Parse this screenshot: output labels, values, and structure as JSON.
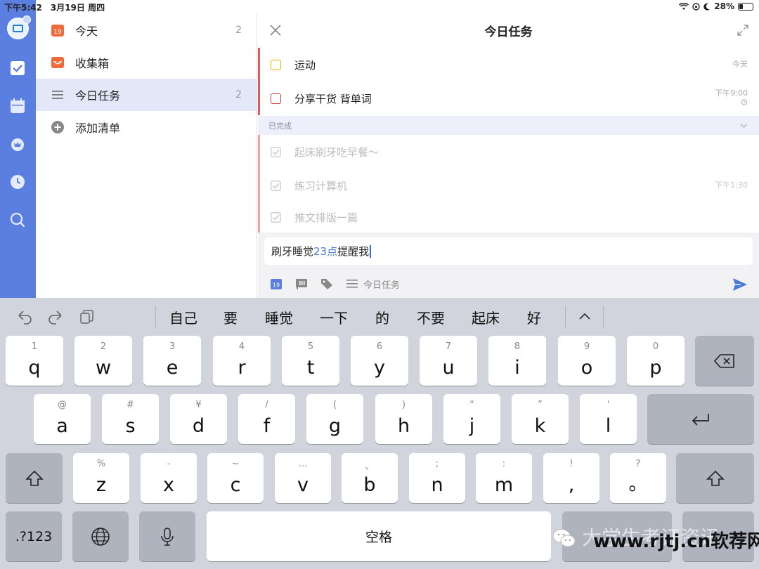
{
  "status_bar": {
    "time": "下午5:42",
    "date": "3月19日 周四",
    "battery": "28%",
    "battery_level": 0.28
  },
  "rail": {
    "icons": [
      "avatar-icon",
      "checkbox-icon",
      "calendar-icon",
      "habit-icon",
      "clock-icon",
      "search-icon"
    ]
  },
  "lists": {
    "items": [
      {
        "label": "今天",
        "count": "2",
        "icon": "calendar-19-icon",
        "icon_color": "#f06a3c",
        "date_badge": "19"
      },
      {
        "label": "收集箱",
        "count": "",
        "icon": "inbox-icon",
        "icon_color": "#f06a3c"
      },
      {
        "label": "今日任务",
        "count": "2",
        "icon": "list-icon",
        "icon_color": "#777777"
      },
      {
        "label": "添加清单",
        "count": "",
        "icon": "add-circle-icon",
        "icon_color": "#888888"
      }
    ]
  },
  "detail": {
    "title": "今日任务",
    "tasks": [
      {
        "label": "运动",
        "meta": "今天",
        "checkbox_color": "#f0b400"
      },
      {
        "label": "分享干货 背单词",
        "meta": "下午9:00",
        "checkbox_color": "#d04040"
      }
    ],
    "done_label": "已完成",
    "done_tasks": [
      {
        "label": "起床刷牙吃早餐～",
        "meta": ""
      },
      {
        "label": "练习计算机",
        "meta": "下午1:30"
      },
      {
        "label": "推文排版一篇",
        "meta": ""
      }
    ],
    "input": {
      "before": "刷牙睡觉 ",
      "highlight": "23点",
      "after": "提醒我"
    },
    "tools": {
      "list_name": "今日任务",
      "date_badge": "19"
    }
  },
  "keyboard": {
    "suggestions": [
      "自己",
      "要",
      "睡觉",
      "一下",
      "的",
      "不要",
      "起床",
      "好"
    ],
    "row1": [
      {
        "main": "q",
        "alt": "1"
      },
      {
        "main": "w",
        "alt": "2"
      },
      {
        "main": "e",
        "alt": "3"
      },
      {
        "main": "r",
        "alt": "4"
      },
      {
        "main": "t",
        "alt": "5"
      },
      {
        "main": "y",
        "alt": "6"
      },
      {
        "main": "u",
        "alt": "7"
      },
      {
        "main": "i",
        "alt": "8"
      },
      {
        "main": "o",
        "alt": "9"
      },
      {
        "main": "p",
        "alt": "0"
      }
    ],
    "row2": [
      {
        "main": "a",
        "alt": "@"
      },
      {
        "main": "s",
        "alt": "#"
      },
      {
        "main": "d",
        "alt": "¥"
      },
      {
        "main": "f",
        "alt": "/"
      },
      {
        "main": "g",
        "alt": "("
      },
      {
        "main": "h",
        "alt": ")"
      },
      {
        "main": "j",
        "alt": "“"
      },
      {
        "main": "k",
        "alt": "”"
      },
      {
        "main": "l",
        "alt": "'"
      }
    ],
    "row3": [
      {
        "main": "z",
        "alt": "%"
      },
      {
        "main": "x",
        "alt": "-"
      },
      {
        "main": "c",
        "alt": "~"
      },
      {
        "main": "v",
        "alt": "…"
      },
      {
        "main": "b",
        "alt": "、"
      },
      {
        "main": "n",
        "alt": ";"
      },
      {
        "main": "m",
        "alt": ":"
      },
      {
        "main": ",",
        "alt": "!"
      },
      {
        "main": "。",
        "alt": "?"
      }
    ],
    "numbers_label": ".?123",
    "space_label": "空格"
  },
  "watermark": {
    "ghost_text": "大学生考证资讯",
    "url_text": "www.rjtj.cn软荐网"
  }
}
